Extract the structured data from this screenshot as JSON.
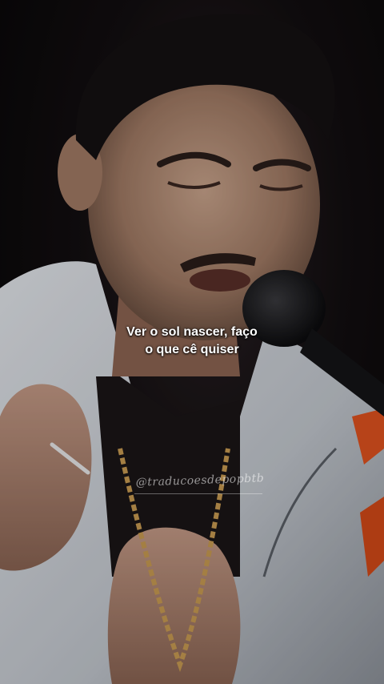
{
  "video": {
    "caption": "Ver o sol nascer, faço\no que cê quiser",
    "watermark": "@traducoesdepopbtb"
  },
  "icons": {
    "scene": "singer-with-microphone-photo"
  },
  "colors": {
    "background": "#0b0a0c",
    "caption_text": "#ffffff",
    "jacket": "#d9dde2",
    "accent_orange": "#e0521f"
  }
}
